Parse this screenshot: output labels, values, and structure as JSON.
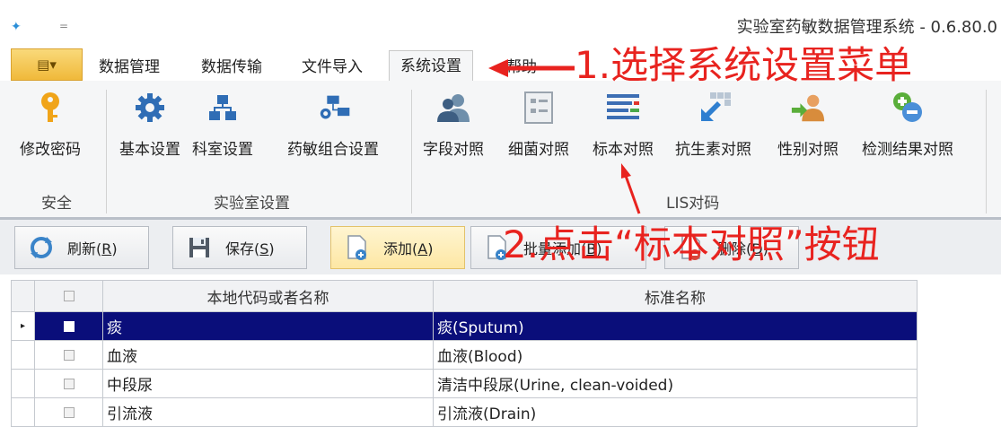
{
  "window": {
    "title": "实验室药敏数据管理系统 - 0.6.80.0",
    "quick_access_dropdown": "=",
    "app_menu_glyph": "▤▾"
  },
  "tabs": [
    "数据管理",
    "数据传输",
    "文件导入",
    "系统设置",
    "帮助"
  ],
  "active_tab": "系统设置",
  "ribbon": {
    "groups": [
      {
        "label": "安全",
        "buttons": [
          {
            "label": "修改密码",
            "icon": "key-icon"
          }
        ]
      },
      {
        "label": "实验室设置",
        "buttons": [
          {
            "label": "基本设置",
            "icon": "gear-icon"
          },
          {
            "label": "科室设置",
            "icon": "org-chart-icon"
          },
          {
            "label": "药敏组合设置",
            "icon": "gear-group-icon"
          }
        ]
      },
      {
        "label": "LIS对码",
        "buttons": [
          {
            "label": "字段对照",
            "icon": "users-icon"
          },
          {
            "label": "细菌对照",
            "icon": "form-icon"
          },
          {
            "label": "标本对照",
            "icon": "lines-icon"
          },
          {
            "label": "抗生素对照",
            "icon": "resize-arrow-icon"
          },
          {
            "label": "性别对照",
            "icon": "user-arrow-icon"
          },
          {
            "label": "检测结果对照",
            "icon": "plus-minus-icon"
          }
        ]
      }
    ]
  },
  "toolbar": {
    "refresh": "刷新(",
    "refresh_key": "R",
    "save": "保存(",
    "save_key": "S",
    "add": "添加(",
    "add_key": "A",
    "batch_add": "批量添加(",
    "batch_add_key": "B",
    "delete": "删除(",
    "delete_key": "D",
    "close_paren": ")"
  },
  "grid": {
    "columns": [
      "本地代码或者名称",
      "标准名称"
    ],
    "rows": [
      {
        "local": "痰",
        "standard": "痰(Sputum)",
        "selected": true
      },
      {
        "local": "血液",
        "standard": "血液(Blood)",
        "selected": false
      },
      {
        "local": "中段尿",
        "standard": "清洁中段尿(Urine, clean-voided)",
        "selected": false
      },
      {
        "local": "引流液",
        "standard": "引流液(Drain)",
        "selected": false
      }
    ]
  },
  "annotations": {
    "step1": "1.选择系统设置菜单",
    "step2": "2.点击“标本对照”按钮"
  },
  "colors": {
    "annotation_red": "#e8231f",
    "selection_navy": "#0a0e7a",
    "app_menu_gold": "#f0b93a"
  }
}
